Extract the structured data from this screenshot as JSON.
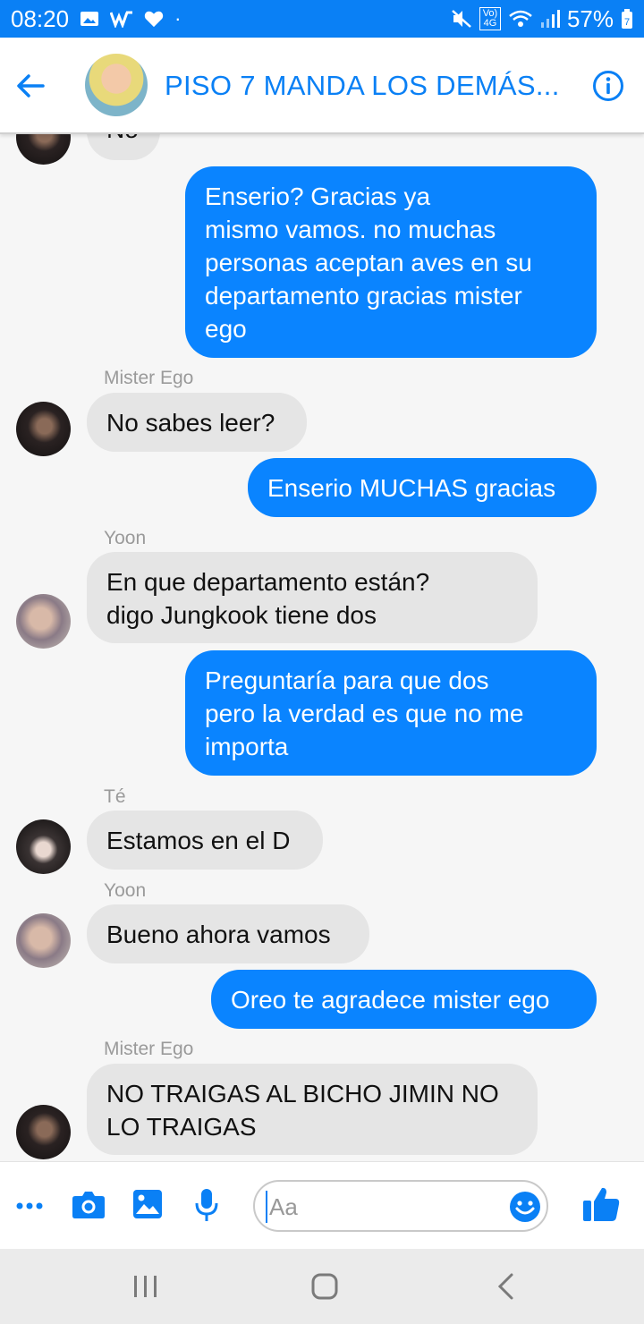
{
  "status": {
    "time": "08:20",
    "battery": "57%",
    "volte": "Vo) 4G"
  },
  "header": {
    "title": "PISO 7 MANDA LOS DEMÁS..."
  },
  "messages": [
    {
      "side": "in",
      "text": "No"
    },
    {
      "side": "out",
      "text": "Enserio? Gracias ya mismo vamos. no muchas personas aceptan aves en su departamento gracias mister ego",
      "lines": [
        "Enserio? Gracias ya",
        "mismo vamos. no muchas",
        "personas aceptan aves en su",
        "departamento gracias mister",
        "ego"
      ]
    },
    {
      "side": "in",
      "sender": "Mister Ego",
      "text": "No sabes leer?"
    },
    {
      "side": "out",
      "text": "Enserio MUCHAS gracias"
    },
    {
      "side": "in",
      "sender": "Yoon",
      "text": "En que departamento están? digo Jungkook tiene dos",
      "lines": [
        "En que departamento están?",
        "digo Jungkook tiene dos"
      ]
    },
    {
      "side": "out",
      "text": "Preguntaría para que dos pero la verdad es que no me importa",
      "lines": [
        "Preguntaría para que dos",
        "pero la verdad es que no me",
        "importa"
      ]
    },
    {
      "side": "in",
      "sender": "Té",
      "text": "Estamos en el D"
    },
    {
      "side": "in",
      "sender": "Yoon",
      "text": "Bueno ahora vamos"
    },
    {
      "side": "out",
      "text": "Oreo te agradece mister ego"
    },
    {
      "side": "in",
      "sender": "Mister Ego",
      "text": "NO TRAIGAS AL BICHO JIMIN NO LO TRAIGAS",
      "lines": [
        "NO TRAIGAS AL BICHO JIMIN NO",
        "LO TRAIGAS"
      ]
    }
  ],
  "composer": {
    "placeholder": "Aa"
  },
  "colors": {
    "accent": "#0a80f5",
    "outgoing_bubble": "#0a84ff",
    "incoming_bubble": "#e5e5e5"
  },
  "icons": [
    "back-arrow-icon",
    "info-icon",
    "more-icon",
    "camera-icon",
    "gallery-icon",
    "microphone-icon",
    "emoji-icon",
    "thumbs-up-icon",
    "recents-icon",
    "home-icon",
    "nav-back-icon"
  ]
}
